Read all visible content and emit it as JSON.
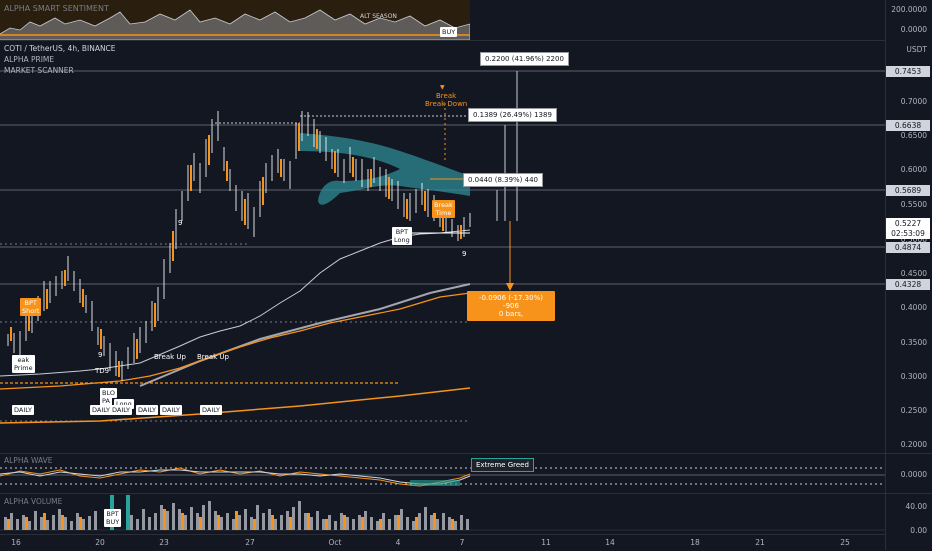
{
  "top_pane": {
    "title": "ALPHA SMART SENTIMENT",
    "tick_high": "200.0000",
    "tick_low": "0.0000",
    "labels": [
      "ALT SEASON",
      "BUY"
    ]
  },
  "symbol": {
    "title": "COTI / TetherUS, 4h, BINANCE",
    "ind1": "ALPHA PRIME",
    "ind2": "MARKET SCANNER"
  },
  "currency": "USDT",
  "price_ticks": [
    "0.7000",
    "0.6500",
    "0.6000",
    "0.5500",
    "0.5000",
    "0.4500",
    "0.4000",
    "0.3500",
    "0.3000",
    "0.2500",
    "0.2000"
  ],
  "price_tags": {
    "t1": "0.7453",
    "t2": "0.6638",
    "t3": "0.5689",
    "t4": "0.5227",
    "countdown": "02:53:09",
    "t5": "0.4874",
    "t6": "0.4328"
  },
  "callouts": {
    "c1": "0.2200 (41.96%) 2200",
    "c2": "0.1389 (26.49%) 1389",
    "c3": "0.0440 (8.39%) 440",
    "drop_line1": "-0.0906 (-17.30%) -906",
    "drop_line2": "0 bars,"
  },
  "annotations": {
    "break_down_1": "Break",
    "break_down_2": "Break Down",
    "break_time_1": "Break",
    "break_time_2": "Time",
    "bpt_long_1_a": "BPT",
    "bpt_long_1_b": "Long",
    "bpt_short_a": "BPT",
    "bpt_short_b": "Short",
    "break_prime_a": "eak",
    "break_prime_b": "Prime",
    "break_up_1": "Break Up",
    "break_up_2": "Break Up",
    "td9": "TD9",
    "nine_a": "9",
    "nine_b": "9",
    "nine_c": "9",
    "daily": "DAILY",
    "blo": "BLO",
    "pa": "PA",
    "long": "Long"
  },
  "wave": {
    "title": "ALPHA WAVE",
    "extreme": "Extreme Greed",
    "tick": "0.0000"
  },
  "volume": {
    "title": "ALPHA VOLUME",
    "bpt": "BPT",
    "buy": "BUY",
    "tick_high": "40.00",
    "tick_low": "0.00"
  },
  "dates": [
    "16",
    "20",
    "23",
    "27",
    "Oct",
    "4",
    "7",
    "11",
    "14",
    "18",
    "21",
    "25"
  ],
  "colors": {
    "bg": "#131722",
    "orange": "#f7931a",
    "teal": "#26a69a",
    "cloud": "#2e8b95"
  }
}
